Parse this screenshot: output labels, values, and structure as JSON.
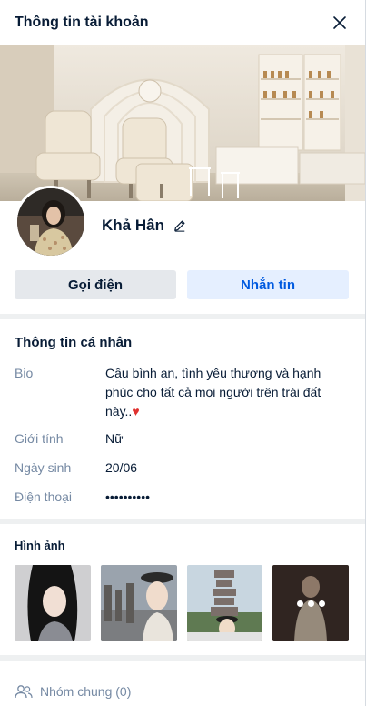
{
  "header": {
    "title": "Thông tin tài khoản"
  },
  "profile": {
    "name": "Khả Hân"
  },
  "actions": {
    "call_label": "Gọi điện",
    "message_label": "Nhắn tin"
  },
  "personal_info": {
    "title": "Thông tin cá nhân",
    "rows": [
      {
        "label": "Bio",
        "value": "Cầu bình an, tình yêu thương và hạnh phúc cho tất cả mọi người trên trái đất này.."
      },
      {
        "label": "Giới tính",
        "value": "Nữ"
      },
      {
        "label": "Ngày sinh",
        "value": "20/06"
      },
      {
        "label": "Điện thoại",
        "value": "••••••••••"
      }
    ]
  },
  "images": {
    "title": "Hình ảnh"
  },
  "groups": {
    "label": "Nhóm chung (0)"
  },
  "icons": {
    "close": "close-icon",
    "edit": "pencil-icon",
    "groups": "users-icon",
    "heart": "heart-icon",
    "more": "more-dots-icon"
  },
  "colors": {
    "primary": "#005ae0",
    "message_bg": "#e5efff",
    "call_bg": "#e5e8ec",
    "label_gray": "#7589a3",
    "separator": "#eef0f1",
    "heart": "#e0312f"
  }
}
